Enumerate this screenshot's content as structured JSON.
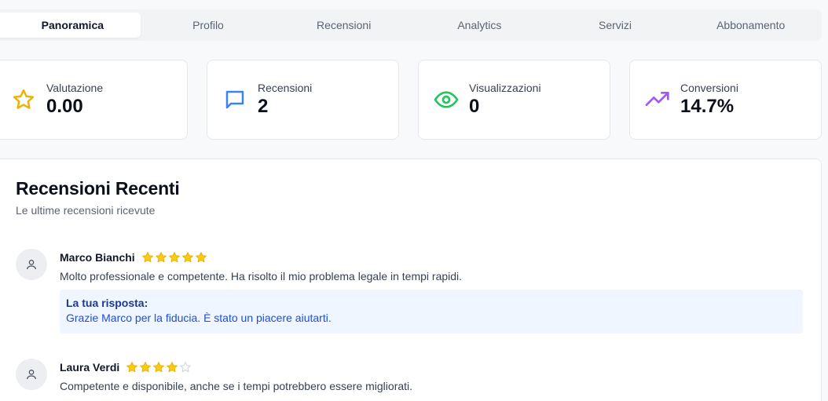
{
  "tabs": [
    "Panoramica",
    "Profilo",
    "Recensioni",
    "Analytics",
    "Servizi",
    "Abbonamento"
  ],
  "active_tab": "Panoramica",
  "stats": [
    {
      "label": "Valutazione",
      "value": "0.00",
      "icon": "star-icon",
      "color": "#eab308"
    },
    {
      "label": "Recensioni",
      "value": "2",
      "icon": "message-icon",
      "color": "#3b82f6"
    },
    {
      "label": "Visualizzazioni",
      "value": "0",
      "icon": "eye-icon",
      "color": "#22c55e"
    },
    {
      "label": "Conversioni",
      "value": "14.7%",
      "icon": "trending-up-icon",
      "color": "#a855f7"
    }
  ],
  "reviews_panel": {
    "title": "Recensioni Recenti",
    "subtitle": "Le ultime recensioni ricevute",
    "reviews": [
      {
        "name": "Marco Bianchi",
        "rating": 5,
        "text": "Molto professionale e competente. Ha risolto il mio problema legale in tempi rapidi.",
        "reply_label": "La tua risposta:",
        "reply_text": "Grazie Marco per la fiducia. È stato un piacere aiutarti."
      },
      {
        "name": "Laura Verdi",
        "rating": 4,
        "text": "Competente e disponibile, anche se i tempi potrebbero essere migliorati."
      }
    ]
  }
}
